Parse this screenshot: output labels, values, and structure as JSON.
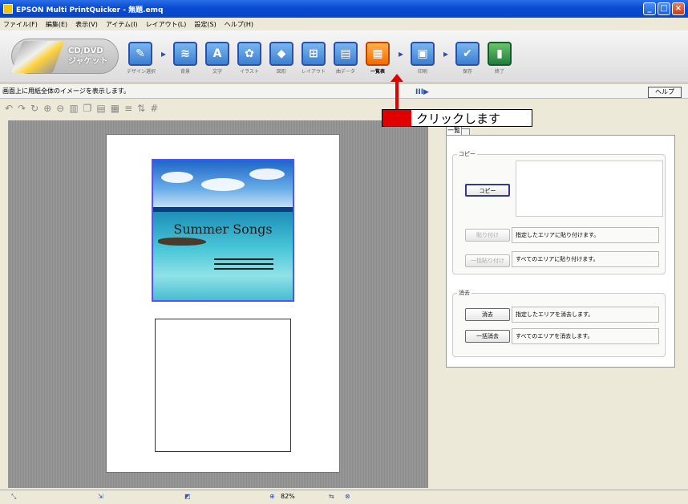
{
  "window": {
    "title": "EPSON Multi PrintQuicker - 無題.emq",
    "minimize": "_",
    "maximize": "□",
    "close": "×"
  },
  "menu": [
    "ファイル(F)",
    "編集(E)",
    "表示(V)",
    "アイテム(I)",
    "レイアウト(L)",
    "設定(S)",
    "ヘルプ(H)"
  ],
  "logo": {
    "line1": "CD/DVD",
    "line2": "ジャケット"
  },
  "tools": [
    {
      "id": "design",
      "label": "デザイン選択",
      "glyph": "✎"
    },
    {
      "id": "background",
      "label": "背景",
      "glyph": "≋"
    },
    {
      "id": "text",
      "label": "文字",
      "glyph": "A"
    },
    {
      "id": "illust",
      "label": "イラスト",
      "glyph": "✿"
    },
    {
      "id": "shape",
      "label": "図形",
      "glyph": "◆"
    },
    {
      "id": "layout",
      "label": "レイアウト",
      "glyph": "⊞"
    },
    {
      "id": "data",
      "label": "曲データ",
      "glyph": "▤"
    },
    {
      "id": "overview",
      "label": "一覧表",
      "glyph": "▦"
    },
    {
      "id": "print",
      "label": "印刷",
      "glyph": "▣"
    },
    {
      "id": "save",
      "label": "保存",
      "glyph": "✔"
    },
    {
      "id": "exit",
      "label": "終了",
      "glyph": "▮"
    }
  ],
  "status_hint": "画面上に用紙全体のイメージを表示します。",
  "help_button": "ヘルプ",
  "play_icon": "III▶",
  "callout": {
    "text": "クリックします"
  },
  "cover": {
    "title": "Summer Songs"
  },
  "panel": {
    "tab": "一覧",
    "copy_group": "コピー",
    "copy_button": "コピー",
    "paste_button": "貼り付け",
    "paste_desc": "指定したエリアに貼り付けます。",
    "paste_all_button": "一括貼り付け",
    "paste_all_desc": "すべてのエリアに貼り付けます。",
    "delete_group": "消去",
    "delete_button": "消去",
    "delete_desc": "指定したエリアを消去します。",
    "delete_all_button": "一括消去",
    "delete_all_desc": "すべてのエリアを消去します。"
  },
  "statusbar": {
    "zoom": "82%"
  },
  "colors": {
    "accent": "#e00000",
    "titlebar": "#0a4bd3",
    "active_tool": "#f26b00"
  }
}
